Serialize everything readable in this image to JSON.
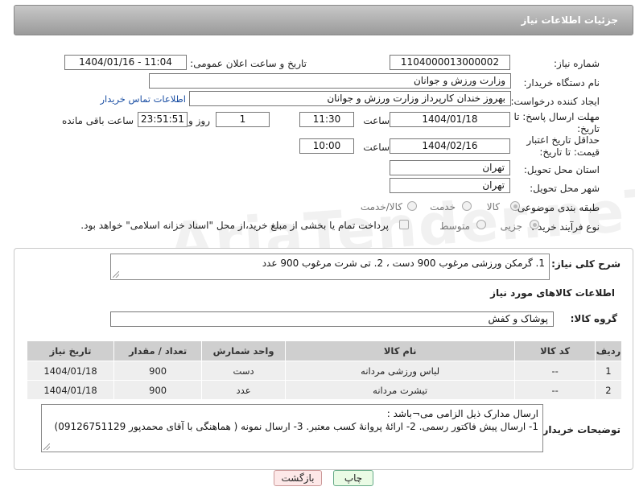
{
  "header": {
    "title": "جزئیات اطلاعات نیاز"
  },
  "fields": {
    "need_number": {
      "label": "شماره نیاز:",
      "value": "1104000013000002"
    },
    "announce_datetime": {
      "label": "تاریخ و ساعت اعلان عمومی:",
      "value": "1404/01/16 - 11:04"
    },
    "buyer_org": {
      "label": "نام دستگاه خریدار:",
      "value": "وزارت ورزش و جوانان"
    },
    "requester": {
      "label": "ایجاد کننده درخواست:",
      "value": "بهروز  خندان  کارپرداز وزارت ورزش و جوانان",
      "contact_link": "اطلاعات تماس خریدار"
    },
    "reply_deadline": {
      "label": "مهلت ارسال پاسخ: تا تاریخ:",
      "date": "1404/01/18",
      "time_label": "ساعت",
      "time": "11:30",
      "days": "1",
      "days_label": "روز و",
      "remaining": "23:51:51",
      "remaining_label": "ساعت باقی مانده"
    },
    "price_validity": {
      "label": "حداقل تاریخ اعتبار قیمت: تا تاریخ:",
      "date": "1404/02/16",
      "time_label": "ساعت",
      "time": "10:00"
    },
    "delivery_province": {
      "label": "استان محل تحویل:",
      "value": "تهران"
    },
    "delivery_city": {
      "label": "شهر محل تحویل:",
      "value": "تهران"
    },
    "category": {
      "label": "طبقه بندی موضوعی:",
      "options": [
        "کالا",
        "خدمت",
        "کالا/خدمت"
      ],
      "selected": "کالا"
    },
    "purchase_type": {
      "label": "نوع فرآیند خرید :",
      "options": [
        "جزیی",
        "متوسط"
      ],
      "selected": "جزیی",
      "payment_note": "پرداخت تمام یا بخشی از مبلغ خرید،از محل \"اسناد خزانه اسلامی\" خواهد بود."
    }
  },
  "description": {
    "label": "شرح کلی نیاز:",
    "value": "1. گرمکن ورزشی مرغوب 900 دست ، 2. تی شرت مرغوب 900 عدد"
  },
  "goods_section": {
    "title": "اطلاعات کالاهای مورد نیاز",
    "group_label": "گروه کالا:",
    "group_value": "پوشاک و کفش",
    "table": {
      "headers": [
        "ردیف",
        "کد کالا",
        "نام کالا",
        "واحد شمارش",
        "تعداد / مقدار",
        "تاریخ نیاز"
      ],
      "rows": [
        [
          "1",
          "--",
          "لباس ورزشی مردانه",
          "دست",
          "900",
          "1404/01/18"
        ],
        [
          "2",
          "--",
          "تیشرت مردانه",
          "عدد",
          "900",
          "1404/01/18"
        ]
      ]
    }
  },
  "buyer_notes": {
    "label": "توضیحات خریدار:",
    "line1": "ارسال مدارک ذیل الزامی می¬باشد :",
    "line2": "1- ارسال پیش فاکتور رسمی. 2- ارائهٔ پروانهٔ کسب معتبر. 3- ارسال نمونه ( هماهنگی با آقای محمدپور 09126751129)"
  },
  "buttons": {
    "print": "چاپ",
    "back": "بازگشت"
  },
  "watermark": "AriaTender.neT"
}
